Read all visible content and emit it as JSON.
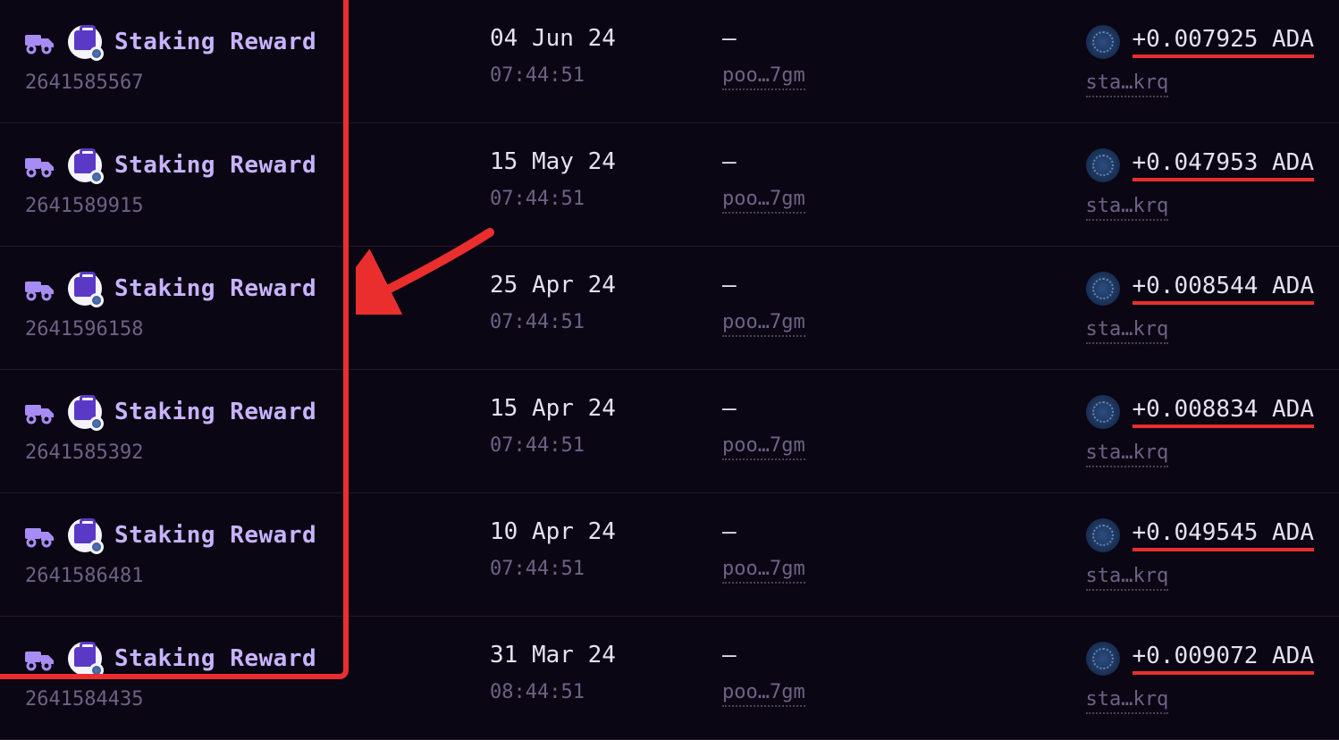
{
  "rows": [
    {
      "title": "Staking Reward",
      "txid": "2641585567",
      "date": "04 Jun 24",
      "time": "07:44:51",
      "dash": "—",
      "pool": "poo…7gm",
      "amount": "+0.007925 ADA",
      "stake": "sta…krq"
    },
    {
      "title": "Staking Reward",
      "txid": "2641589915",
      "date": "15 May 24",
      "time": "07:44:51",
      "dash": "—",
      "pool": "poo…7gm",
      "amount": "+0.047953 ADA",
      "stake": "sta…krq"
    },
    {
      "title": "Staking Reward",
      "txid": "2641596158",
      "date": "25 Apr 24",
      "time": "07:44:51",
      "dash": "—",
      "pool": "poo…7gm",
      "amount": "+0.008544 ADA",
      "stake": "sta…krq"
    },
    {
      "title": "Staking Reward",
      "txid": "2641585392",
      "date": "15 Apr 24",
      "time": "07:44:51",
      "dash": "—",
      "pool": "poo…7gm",
      "amount": "+0.008834 ADA",
      "stake": "sta…krq"
    },
    {
      "title": "Staking Reward",
      "txid": "2641586481",
      "date": "10 Apr 24",
      "time": "07:44:51",
      "dash": "—",
      "pool": "poo…7gm",
      "amount": "+0.049545 ADA",
      "stake": "sta…krq"
    },
    {
      "title": "Staking Reward",
      "txid": "2641584435",
      "date": "31 Mar 24",
      "time": "08:44:51",
      "dash": "—",
      "pool": "poo…7gm",
      "amount": "+0.009072 ADA",
      "stake": "sta…krq"
    }
  ]
}
